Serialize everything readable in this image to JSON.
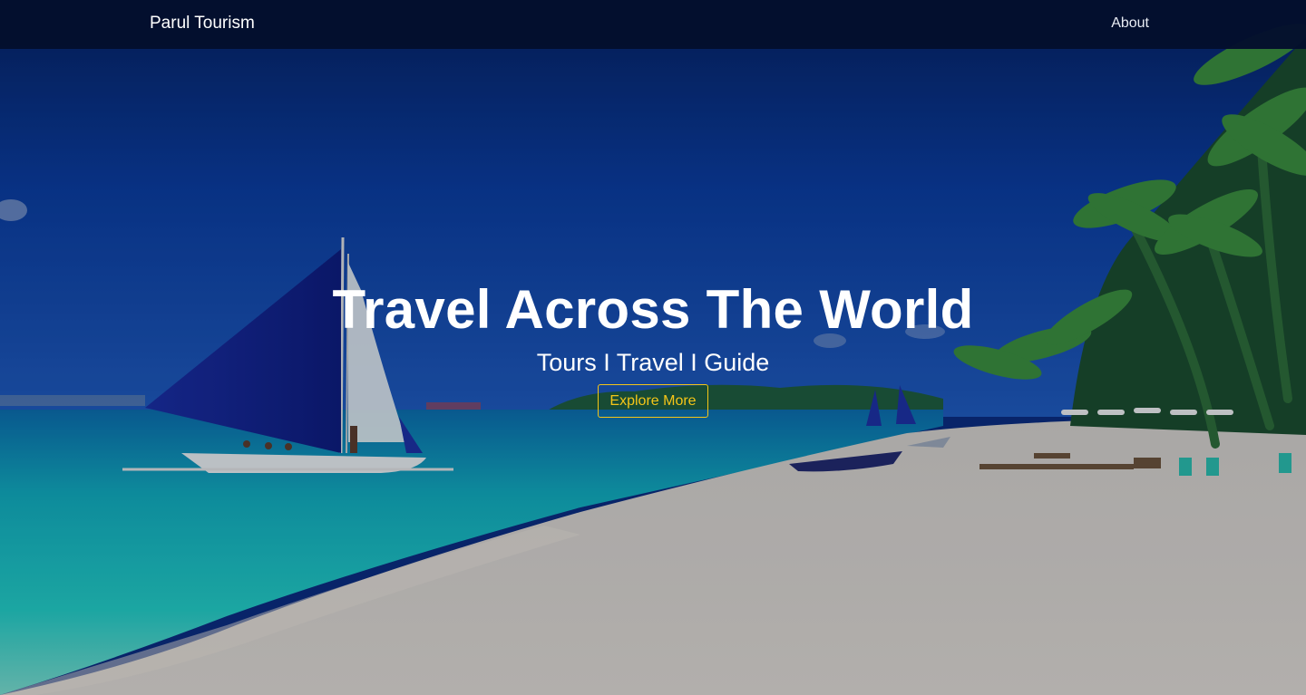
{
  "navbar": {
    "brand": "Parul Tourism",
    "links": [
      {
        "label": "About"
      }
    ]
  },
  "hero": {
    "title": "Travel Across The World",
    "subtitle": "Tours I Travel I Guide",
    "cta_label": "Explore More"
  },
  "colors": {
    "navbar_bg": "#030f2d",
    "cta_accent": "#f5c518",
    "text": "#ffffff"
  }
}
